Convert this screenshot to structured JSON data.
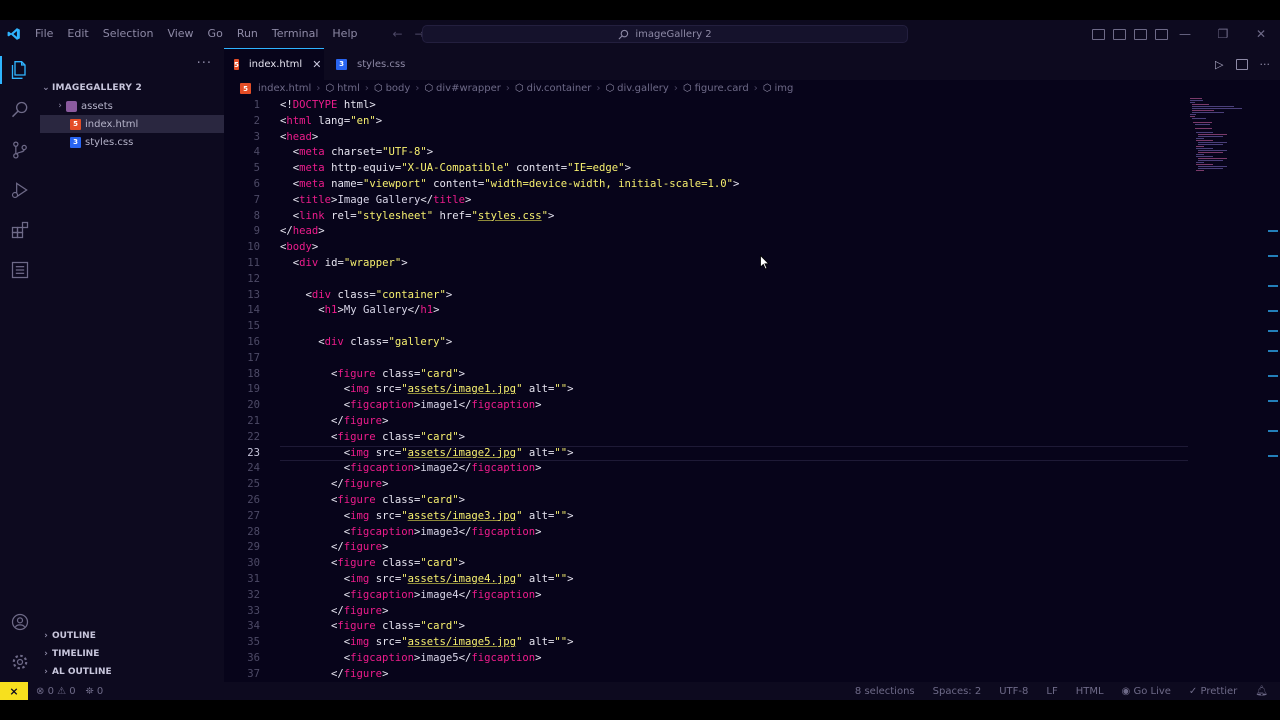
{
  "window": {
    "command_center_text": "imageGallery 2"
  },
  "menu": [
    "File",
    "Edit",
    "Selection",
    "View",
    "Go",
    "Run",
    "Terminal",
    "Help"
  ],
  "explorer": {
    "root": "IMAGEGALLERY 2",
    "items": [
      {
        "label": "assets",
        "kind": "folder"
      },
      {
        "label": "index.html",
        "kind": "html"
      },
      {
        "label": "styles.css",
        "kind": "css"
      }
    ],
    "sections": [
      "OUTLINE",
      "TIMELINE",
      "AL OUTLINE"
    ]
  },
  "tabs": [
    {
      "label": "index.html",
      "active": true
    },
    {
      "label": "styles.css",
      "active": false
    }
  ],
  "breadcrumb": [
    "index.html",
    "html",
    "body",
    "div#wrapper",
    "div.container",
    "div.gallery",
    "figure.card",
    "img"
  ],
  "editor": {
    "active_line": 23,
    "lines": [
      {
        "n": "1",
        "text": "<!DOCTYPE html>"
      },
      {
        "n": "2",
        "text": "<html lang=\"en\">"
      },
      {
        "n": "3",
        "text": "<head>"
      },
      {
        "n": "4",
        "text": "  <meta charset=\"UTF-8\">"
      },
      {
        "n": "5",
        "text": "  <meta http-equiv=\"X-UA-Compatible\" content=\"IE=edge\">"
      },
      {
        "n": "6",
        "text": "  <meta name=\"viewport\" content=\"width=device-width, initial-scale=1.0\">"
      },
      {
        "n": "7",
        "text": "  <title>Image Gallery</title>"
      },
      {
        "n": "8",
        "text": "  <link rel=\"stylesheet\" href=\"styles.css\">"
      },
      {
        "n": "9",
        "text": "</head>"
      },
      {
        "n": "10",
        "text": "<body>"
      },
      {
        "n": "11",
        "text": "  <div id=\"wrapper\">"
      },
      {
        "n": "12",
        "text": ""
      },
      {
        "n": "13",
        "text": "    <div class=\"container\">"
      },
      {
        "n": "14",
        "text": "      <h1>My Gallery</h1>"
      },
      {
        "n": "15",
        "text": ""
      },
      {
        "n": "16",
        "text": "      <div class=\"gallery\">"
      },
      {
        "n": "17",
        "text": ""
      },
      {
        "n": "18",
        "text": "        <figure class=\"card\">"
      },
      {
        "n": "19",
        "text": "          <img src=\"assets/image1.jpg\" alt=\"\">"
      },
      {
        "n": "20",
        "text": "          <figcaption>image1</figcaption>"
      },
      {
        "n": "21",
        "text": "        </figure>"
      },
      {
        "n": "22",
        "text": "        <figure class=\"card\">"
      },
      {
        "n": "23",
        "text": "          <img src=\"assets/image2.jpg\" alt=\"\">"
      },
      {
        "n": "24",
        "text": "          <figcaption>image2</figcaption>"
      },
      {
        "n": "25",
        "text": "        </figure>"
      },
      {
        "n": "26",
        "text": "        <figure class=\"card\">"
      },
      {
        "n": "27",
        "text": "          <img src=\"assets/image3.jpg\" alt=\"\">"
      },
      {
        "n": "28",
        "text": "          <figcaption>image3</figcaption>"
      },
      {
        "n": "29",
        "text": "        </figure>"
      },
      {
        "n": "30",
        "text": "        <figure class=\"card\">"
      },
      {
        "n": "31",
        "text": "          <img src=\"assets/image4.jpg\" alt=\"\">"
      },
      {
        "n": "32",
        "text": "          <figcaption>image4</figcaption>"
      },
      {
        "n": "33",
        "text": "        </figure>"
      },
      {
        "n": "34",
        "text": "        <figure class=\"card\">"
      },
      {
        "n": "35",
        "text": "          <img src=\"assets/image5.jpg\" alt=\"\">"
      },
      {
        "n": "36",
        "text": "          <figcaption>image5</figcaption>"
      },
      {
        "n": "37",
        "text": "        </figure>"
      }
    ]
  },
  "statusbar": {
    "errors": "0",
    "warnings": "0",
    "ports": "0",
    "selections": "8 selections",
    "spaces": "Spaces: 2",
    "encoding": "UTF-8",
    "eol": "LF",
    "language": "HTML",
    "go_live": "Go Live",
    "prettier": "Prettier"
  },
  "colors": {
    "accent": "#2fb4ff",
    "tag": "#ec1c8b",
    "string": "#f7f06f",
    "background": "#07041a",
    "remote": "#f7e01e"
  }
}
